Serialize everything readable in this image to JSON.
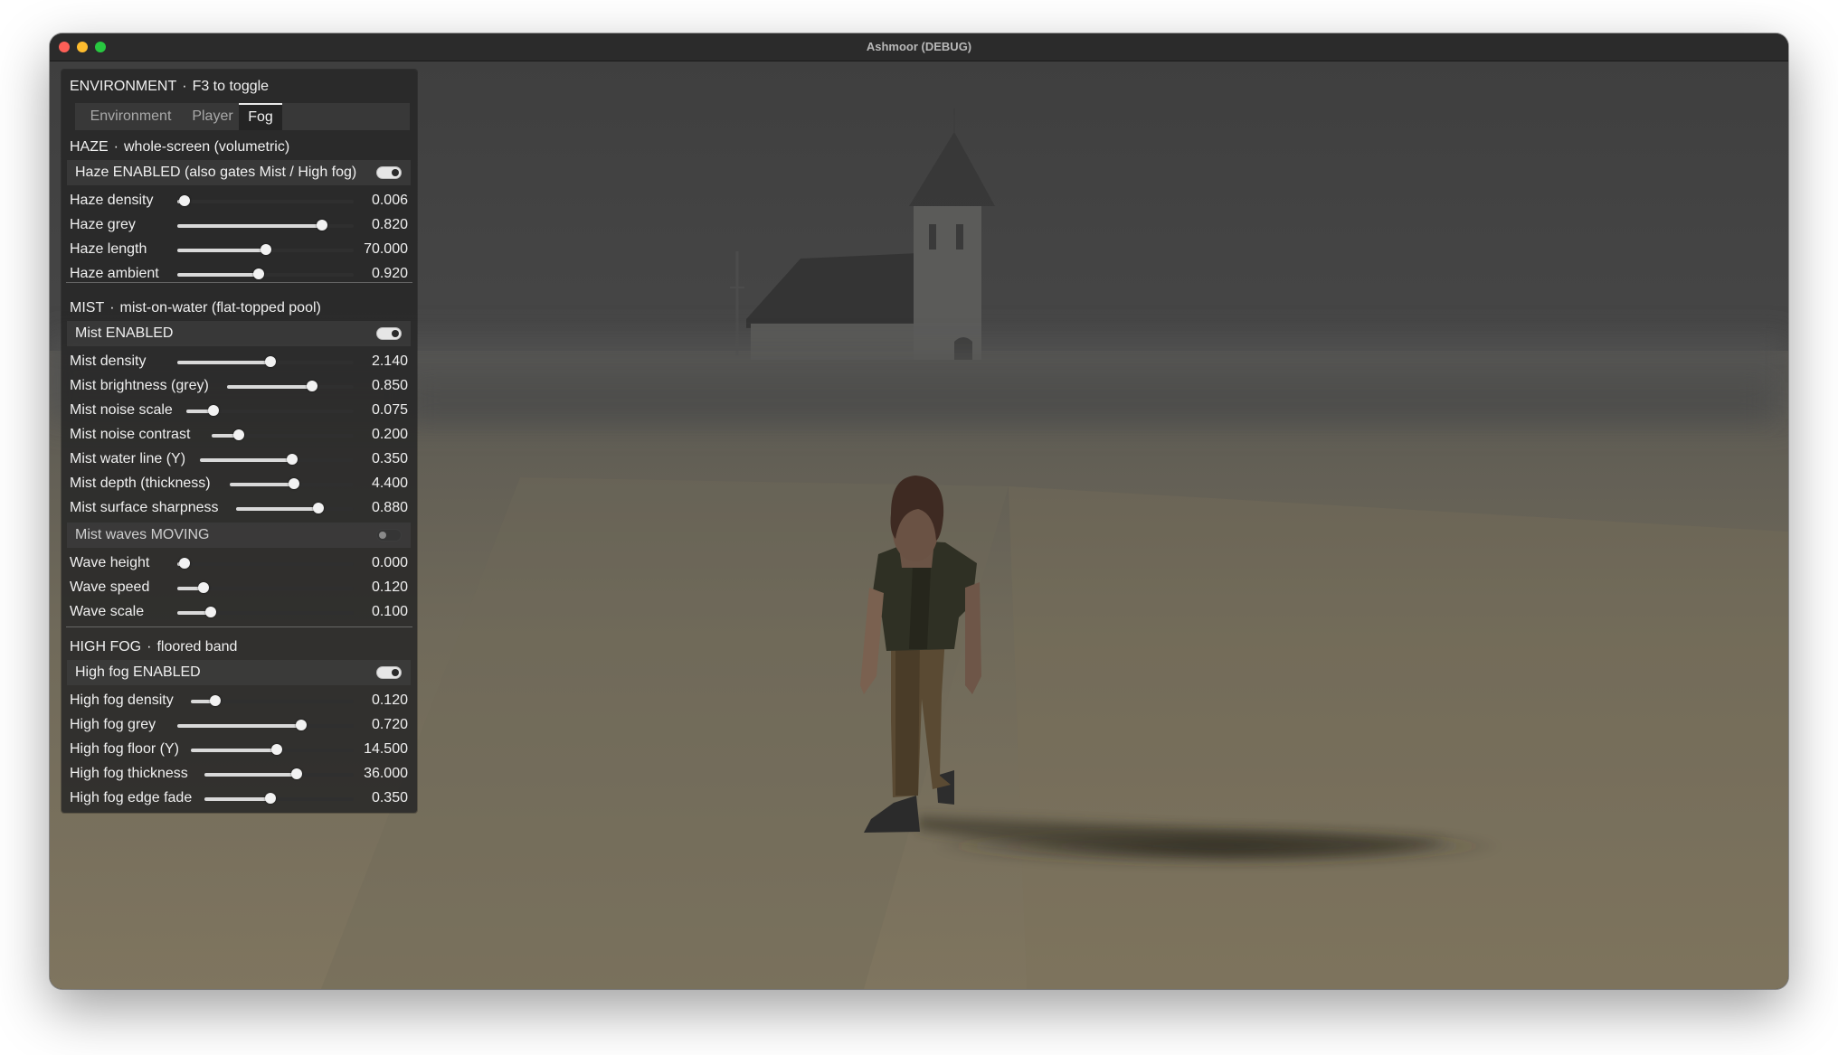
{
  "window": {
    "title": "Ashmoor (DEBUG)"
  },
  "panel": {
    "title": "ENVIRONMENT",
    "hint": "F3 to toggle",
    "tabs": [
      {
        "label": "Environment",
        "active": false
      },
      {
        "label": "Player",
        "active": false
      },
      {
        "label": "Fog",
        "active": true
      }
    ],
    "haze": {
      "header": "HAZE",
      "subtitle": "whole-screen (volumetric)",
      "toggle": {
        "label": "Haze ENABLED  (also gates Mist / High fog)",
        "on": true
      },
      "sliders": [
        {
          "label": "Haze density",
          "value": "0.006",
          "fraction": 0.04
        },
        {
          "label": "Haze grey",
          "value": "0.820",
          "fraction": 0.82
        },
        {
          "label": "Haze length",
          "value": "70.000",
          "fraction": 0.5
        },
        {
          "label": "Haze ambient",
          "value": "0.920",
          "fraction": 0.46
        }
      ]
    },
    "mist": {
      "header": "MIST",
      "subtitle": "mist-on-water (flat-topped pool)",
      "toggle": {
        "label": "Mist ENABLED",
        "on": true
      },
      "sliders": [
        {
          "label": "Mist density",
          "value": "2.140",
          "fraction": 0.53
        },
        {
          "label": "Mist brightness (grey)",
          "value": "0.850",
          "fraction": 0.67
        },
        {
          "label": "Mist noise scale",
          "value": "0.075",
          "fraction": 0.16
        },
        {
          "label": "Mist noise contrast",
          "value": "0.200",
          "fraction": 0.19
        },
        {
          "label": "Mist water line (Y)",
          "value": "0.350",
          "fraction": 0.6
        },
        {
          "label": "Mist depth (thickness)",
          "value": "4.400",
          "fraction": 0.52
        },
        {
          "label": "Mist surface sharpness",
          "value": "0.880",
          "fraction": 0.7
        }
      ],
      "waves_toggle": {
        "label": "Mist waves MOVING",
        "on": false
      },
      "wave_sliders": [
        {
          "label": "Wave height",
          "value": "0.000",
          "fraction": 0.04
        },
        {
          "label": "Wave speed",
          "value": "0.120",
          "fraction": 0.15
        },
        {
          "label": "Wave scale",
          "value": "0.100",
          "fraction": 0.19
        }
      ]
    },
    "high_fog": {
      "header": "HIGH FOG",
      "subtitle": "floored band",
      "toggle": {
        "label": "High fog ENABLED",
        "on": true
      },
      "sliders": [
        {
          "label": "High fog density",
          "value": "0.120",
          "fraction": 0.15
        },
        {
          "label": "High fog grey",
          "value": "0.720",
          "fraction": 0.7
        },
        {
          "label": "High fog floor (Y)",
          "value": "14.500",
          "fraction": 0.53
        },
        {
          "label": "High fog thickness",
          "value": "36.000",
          "fraction": 0.62
        },
        {
          "label": "High fog edge fade",
          "value": "0.350",
          "fraction": 0.44
        }
      ]
    }
  },
  "colors": {
    "sky": "#454545",
    "ground_far": "#5f5c52",
    "ground_near": "#7d735e",
    "panel_bg": "#262626",
    "slider_fill": "#d9d9d9",
    "toggle_on": "#e6e6e6",
    "close": "#fe5f57",
    "minimize": "#febc2e",
    "maximize": "#28c840"
  }
}
